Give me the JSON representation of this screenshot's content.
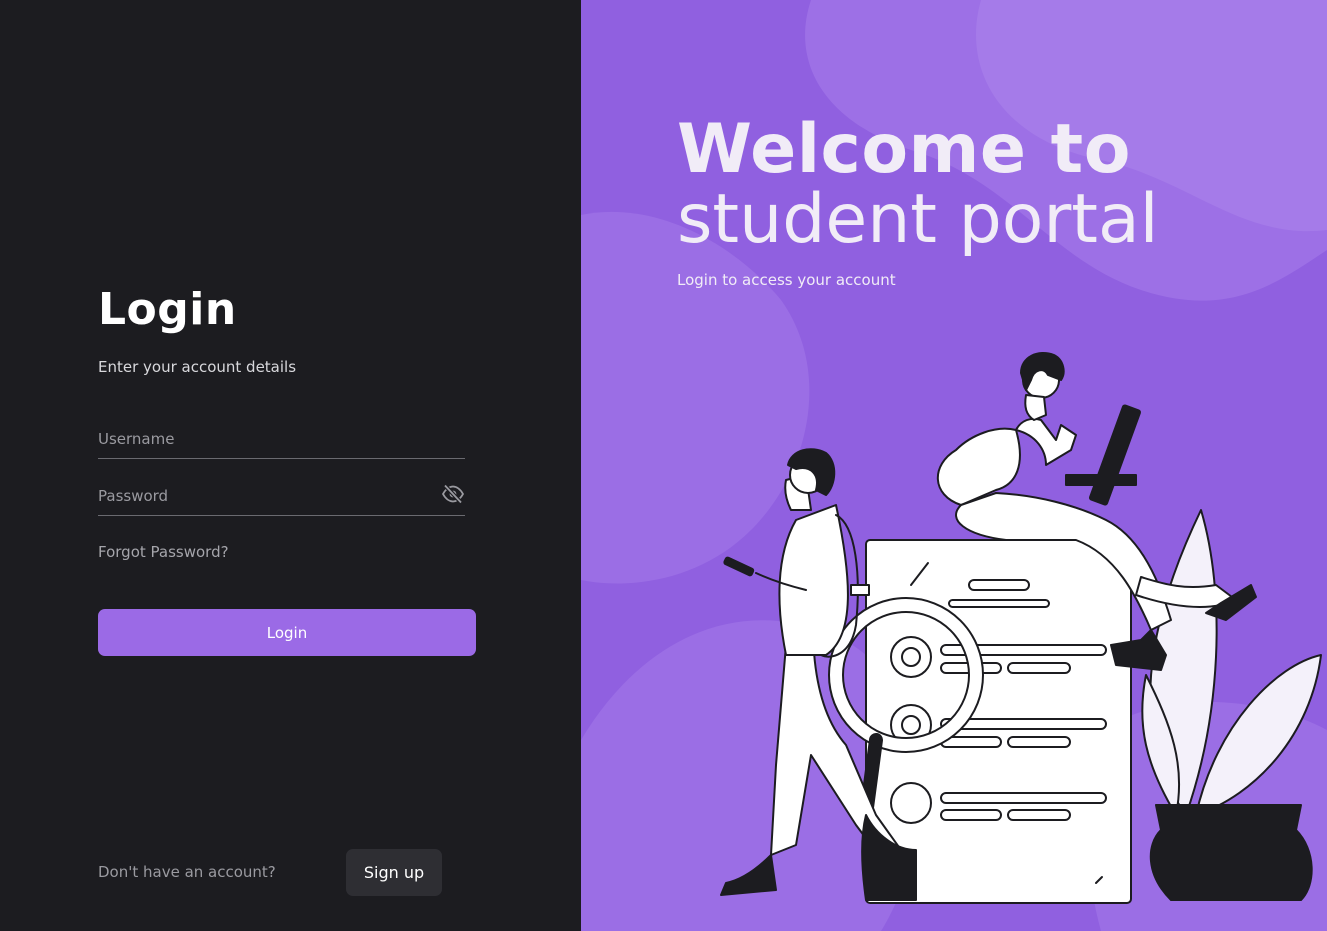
{
  "login": {
    "title": "Login",
    "subtitle": "Enter your account details",
    "username_placeholder": "Username",
    "password_placeholder": "Password",
    "password_toggle_icon": "eye-slash-icon",
    "forgot_password": "Forgot Password?",
    "submit_label": "Login",
    "no_account_text": "Don't have an account?",
    "signup_label": "Sign up"
  },
  "hero": {
    "title_line1": "Welcome to",
    "title_line2": "student portal",
    "subtitle": "Login to access your account",
    "illustration": "students-with-document-illustration"
  },
  "colors": {
    "left_background": "#1c1c20",
    "right_background": "#9060e0",
    "accent_button": "#9b6ae6",
    "secondary_button": "#2e2e33",
    "hero_text": "#f1ecf7"
  }
}
